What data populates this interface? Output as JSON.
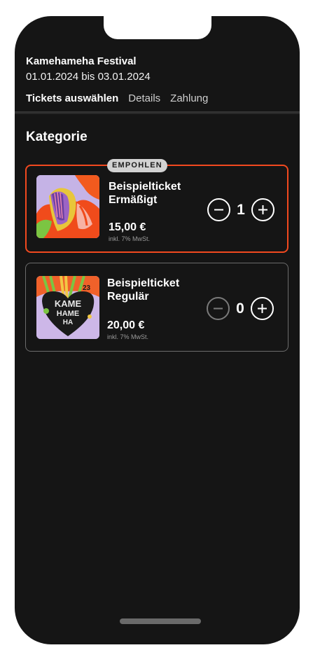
{
  "header": {
    "event_title": "Kamehameha Festival",
    "event_dates": "01.01.2024 bis 03.01.2024",
    "steps": [
      {
        "label": "Tickets auswählen",
        "active": true
      },
      {
        "label": "Details",
        "active": false
      },
      {
        "label": "Zahlung",
        "active": false
      }
    ]
  },
  "section": {
    "title": "Kategorie"
  },
  "tickets": [
    {
      "badge": "EMPOHLEN",
      "name": "Beispielticket Ermäßigt",
      "price": "15,00 €",
      "tax_note": "inkl. 7% MwSt.",
      "quantity": "1",
      "image_icon": "abstract-art-image"
    },
    {
      "name": "Beispielticket Regulär",
      "price": "20,00 €",
      "tax_note": "inkl. 7% MwSt.",
      "quantity": "0",
      "image_icon": "festival-poster-image",
      "image_text": "KAMEHAMEHA SUMMER 23 FESTIVAL"
    }
  ],
  "icons": {
    "decrement": "minus-circle-icon",
    "increment": "plus-circle-icon"
  },
  "colors": {
    "background": "#151515",
    "accent": "#f2491f",
    "badge": "#d2d2d2",
    "border": "#6c6c6c"
  }
}
